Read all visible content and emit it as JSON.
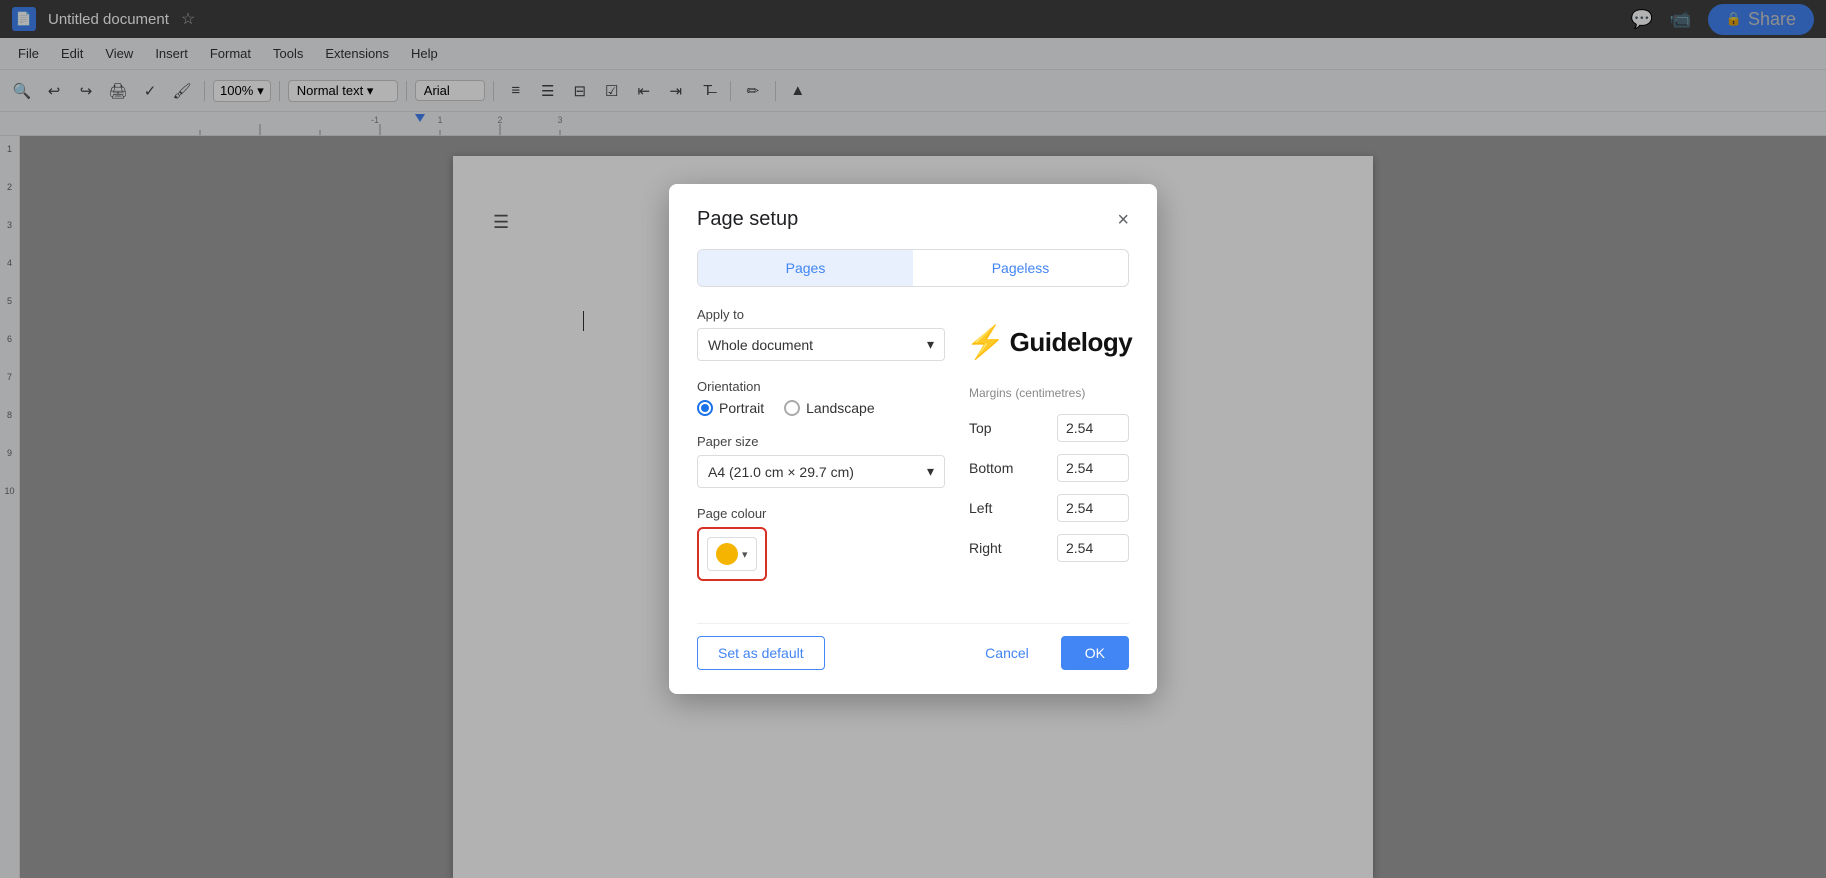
{
  "app": {
    "title": "Untitled document",
    "tab_label": "Untitled document"
  },
  "menubar": {
    "items": [
      "File",
      "Edit",
      "View",
      "Insert",
      "Format",
      "Tools",
      "Extensions",
      "Help"
    ]
  },
  "toolbar": {
    "zoom": "100%",
    "style": "Normal text",
    "font": "Arial"
  },
  "dialog": {
    "title": "Page setup",
    "close_label": "×",
    "tabs": [
      {
        "id": "pages",
        "label": "Pages",
        "active": true
      },
      {
        "id": "pageless",
        "label": "Pageless",
        "active": false
      }
    ],
    "apply_to_label": "Apply to",
    "apply_to_value": "Whole document",
    "orientation_label": "Orientation",
    "orientations": [
      {
        "id": "portrait",
        "label": "Portrait",
        "selected": true
      },
      {
        "id": "landscape",
        "label": "Landscape",
        "selected": false
      }
    ],
    "paper_size_label": "Paper size",
    "paper_size_value": "A4 (21.0 cm × 29.7 cm)",
    "page_colour_label": "Page colour",
    "page_colour_value": "#f4b400",
    "logo_bolt": "⚡",
    "logo_text": "Guidelogy",
    "margins_label": "Margins",
    "margins_unit": "(centimetres)",
    "margins": [
      {
        "id": "top",
        "label": "Top",
        "value": "2.54"
      },
      {
        "id": "bottom",
        "label": "Bottom",
        "value": "2.54"
      },
      {
        "id": "left",
        "label": "Left",
        "value": "2.54"
      },
      {
        "id": "right",
        "label": "Right",
        "value": "2.54"
      }
    ],
    "set_default_label": "Set as default",
    "cancel_label": "Cancel",
    "ok_label": "OK"
  }
}
